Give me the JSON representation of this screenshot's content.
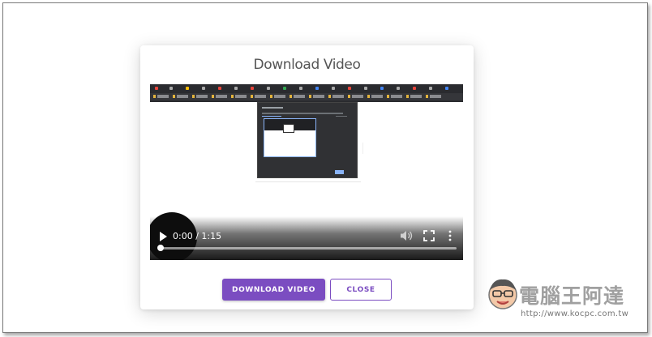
{
  "dialog": {
    "title": "Download Video",
    "download_label": "DOWNLOAD VIDEO",
    "close_label": "CLOSE"
  },
  "player": {
    "time_display": "0:00 / 1:15",
    "progress": 0.0
  },
  "watermark": {
    "name": "電腦王阿達",
    "url": "http://www.kocpc.com.tw"
  },
  "colors": {
    "accent": "#7b4dc1",
    "title": "#555555"
  }
}
